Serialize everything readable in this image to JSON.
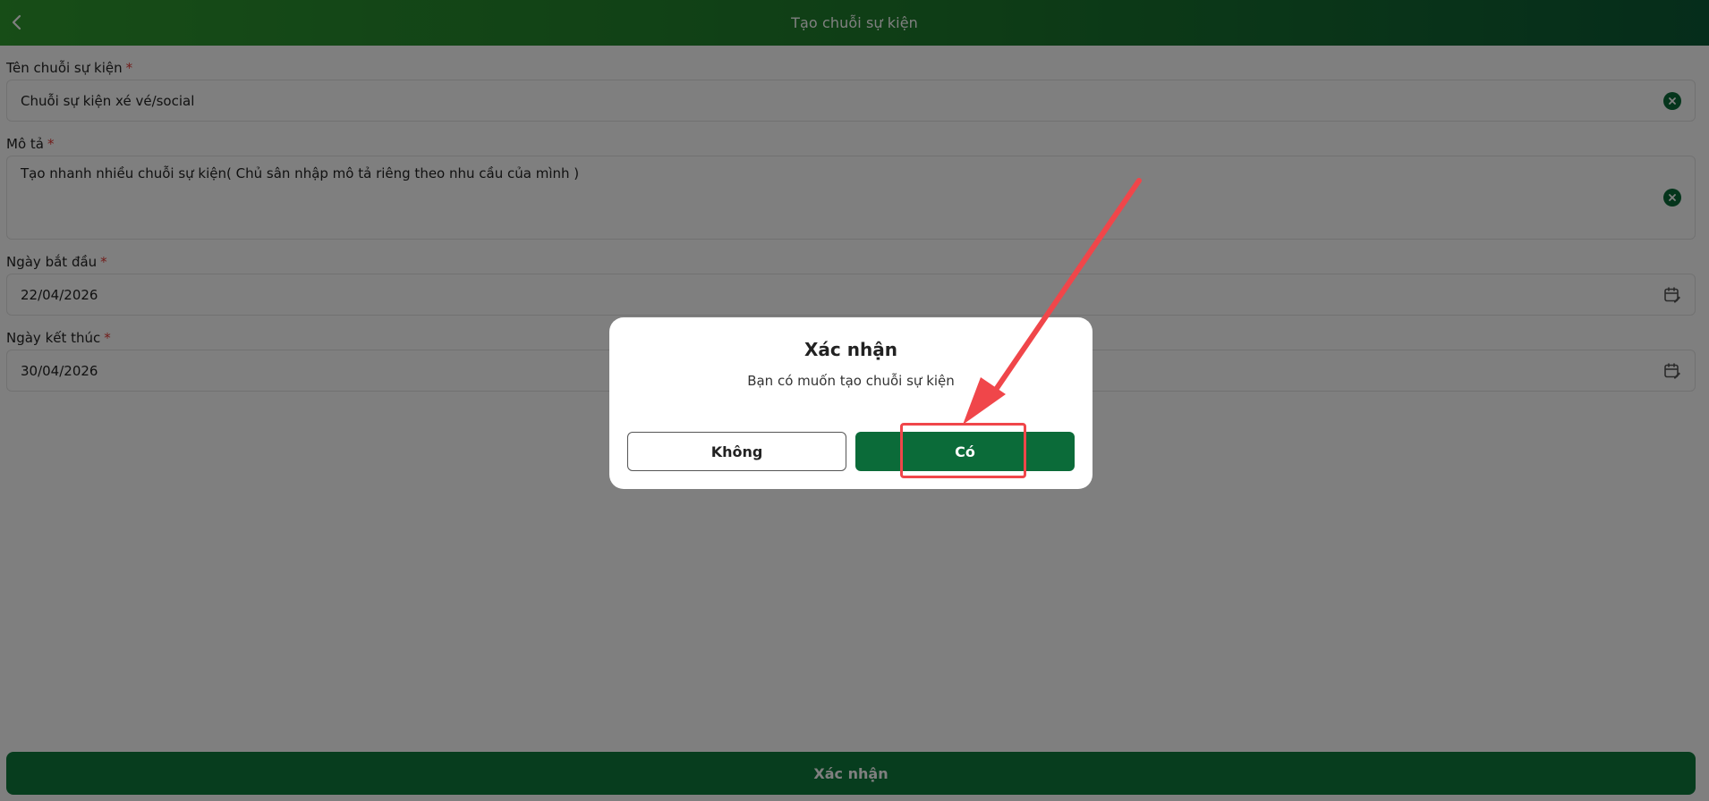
{
  "header": {
    "title": "Tạo chuỗi sự kiện",
    "back_icon": "chevron-left-icon"
  },
  "form": {
    "fields": [
      {
        "label": "Tên chuỗi sự kiện",
        "required_mark": "*",
        "value": "Chuỗi sự kiện xé vé/social",
        "icon": "clear-icon"
      },
      {
        "label": "Mô tả",
        "required_mark": "*",
        "value": "Tạo nhanh nhiều chuỗi sự kiện( Chủ sân nhập mô tả riêng theo nhu cầu của mình )",
        "icon": "clear-icon"
      },
      {
        "label": "Ngày bắt đầu",
        "required_mark": "*",
        "value": "22/04/2026",
        "icon": "calendar-edit-icon"
      },
      {
        "label": "Ngày kết thúc",
        "required_mark": "*",
        "value": "30/04/2026",
        "icon": "calendar-edit-icon"
      }
    ],
    "submit_label": "Xác nhận"
  },
  "dialog": {
    "title": "Xác nhận",
    "message": "Bạn có muốn tạo chuỗi sự kiện",
    "cancel_label": "Không",
    "confirm_label": "Có"
  },
  "colors": {
    "brand_green": "#0b6b39",
    "required_red": "#e53935",
    "annotation_red": "#f0464a"
  }
}
